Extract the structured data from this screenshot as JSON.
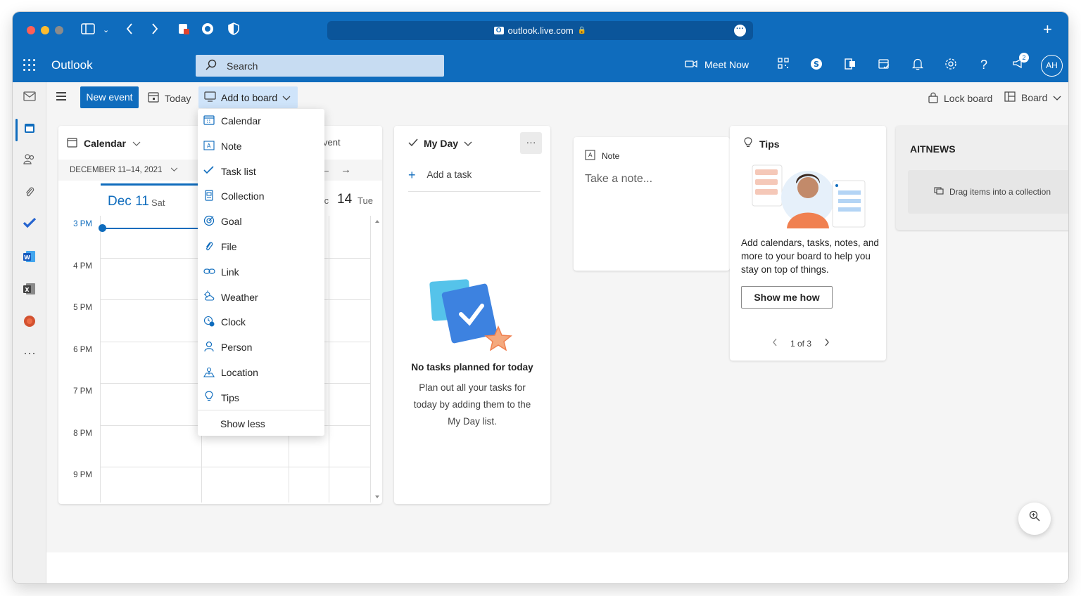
{
  "browser": {
    "url": "outlook.live.com",
    "lock_glyph": "🔒",
    "site_icon": "O",
    "colors": {
      "chrome": "#0f6cbd",
      "url_field": "#0b559a"
    }
  },
  "app": {
    "name": "Outlook",
    "search_placeholder": "Search",
    "meet_now": "Meet Now",
    "notification_count": "2",
    "avatar_initials": "AH",
    "colors": {
      "accent": "#0f6cbd",
      "add_board_bg": "#cfe4fa"
    }
  },
  "toolbar": {
    "new_event": "New event",
    "today": "Today",
    "add_to_board": "Add to board",
    "lock_board": "Lock board",
    "board": "Board"
  },
  "dropdown": {
    "items": [
      {
        "label": "Calendar",
        "icon": "calendar-icon"
      },
      {
        "label": "Note",
        "icon": "note-icon"
      },
      {
        "label": "Task list",
        "icon": "task-list-icon"
      },
      {
        "label": "Collection",
        "icon": "collection-icon"
      },
      {
        "label": "Goal",
        "icon": "goal-icon"
      },
      {
        "label": "File",
        "icon": "paperclip-icon"
      },
      {
        "label": "Link",
        "icon": "link-icon"
      },
      {
        "label": "Weather",
        "icon": "weather-icon"
      },
      {
        "label": "Clock",
        "icon": "clock-icon"
      },
      {
        "label": "Person",
        "icon": "person-icon"
      },
      {
        "label": "Location",
        "icon": "location-icon"
      },
      {
        "label": "Tips",
        "icon": "lightbulb-icon"
      }
    ],
    "show_less": "Show less"
  },
  "calendar_card": {
    "title": "Calendar",
    "range": "DECEMBER 11–14, 2021",
    "event_partial": "vent",
    "day1_num": "Dec 11",
    "day1_dow": "Sat",
    "day2_partial": "Ic",
    "day3_num": "14",
    "day3_dow": "Tue",
    "hours": [
      "3 PM",
      "4 PM",
      "5 PM",
      "6 PM",
      "7 PM",
      "8 PM",
      "9 PM"
    ]
  },
  "myday_card": {
    "title": "My Day",
    "more": "···",
    "add_task": "Add a task",
    "empty_title": "No tasks planned for today",
    "empty_body": "Plan out all your tasks for today by adding them to the My Day list."
  },
  "note_card": {
    "title": "Note",
    "placeholder": "Take a note..."
  },
  "tips_card": {
    "title": "Tips",
    "body": "Add calendars, tasks, notes, and more to your board to help you stay on top of things.",
    "button": "Show me how",
    "pager": "1 of 3"
  },
  "collection_card": {
    "title": "AITNEWS",
    "drop_hint": "Drag items into a collection"
  }
}
